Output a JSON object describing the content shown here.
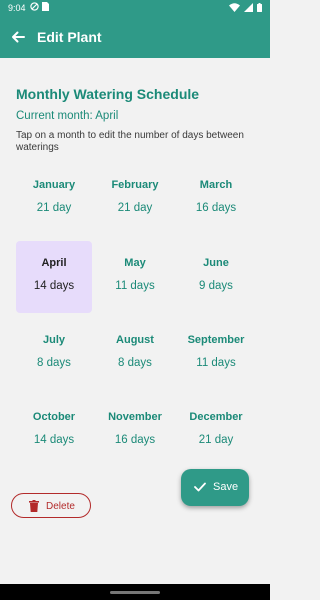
{
  "status_bar": {
    "time": "9:04",
    "left_icons": [
      "do-not-disturb-icon",
      "sim-card-icon"
    ],
    "right_icons": [
      "wifi-icon",
      "cell-signal-icon",
      "battery-icon"
    ]
  },
  "app_bar": {
    "title": "Edit Plant",
    "back_icon": "arrow-back-icon",
    "background": "#2f9a88"
  },
  "schedule": {
    "title": "Monthly Watering Schedule",
    "current_month": "Current month: April",
    "instructions": "Tap on a month to edit the number of days between waterings",
    "selected_month": "April",
    "months": [
      {
        "name": "January",
        "days": "21 day"
      },
      {
        "name": "February",
        "days": "21 day"
      },
      {
        "name": "March",
        "days": "16 days"
      },
      {
        "name": "April",
        "days": "14 days"
      },
      {
        "name": "May",
        "days": "11 days"
      },
      {
        "name": "June",
        "days": "9 days"
      },
      {
        "name": "July",
        "days": "8 days"
      },
      {
        "name": "August",
        "days": "8 days"
      },
      {
        "name": "September",
        "days": "11 days"
      },
      {
        "name": "October",
        "days": "14 days"
      },
      {
        "name": "November",
        "days": "16 days"
      },
      {
        "name": "December",
        "days": "21 day"
      }
    ]
  },
  "actions": {
    "delete_label": "Delete",
    "delete_icon": "trash-icon",
    "save_label": "Save",
    "save_icon": "check-icon"
  },
  "colors": {
    "primary": "#2f9a88",
    "accent_text": "#1b8a78",
    "selected_bg": "#e7dcfb",
    "danger": "#b32b2b"
  }
}
